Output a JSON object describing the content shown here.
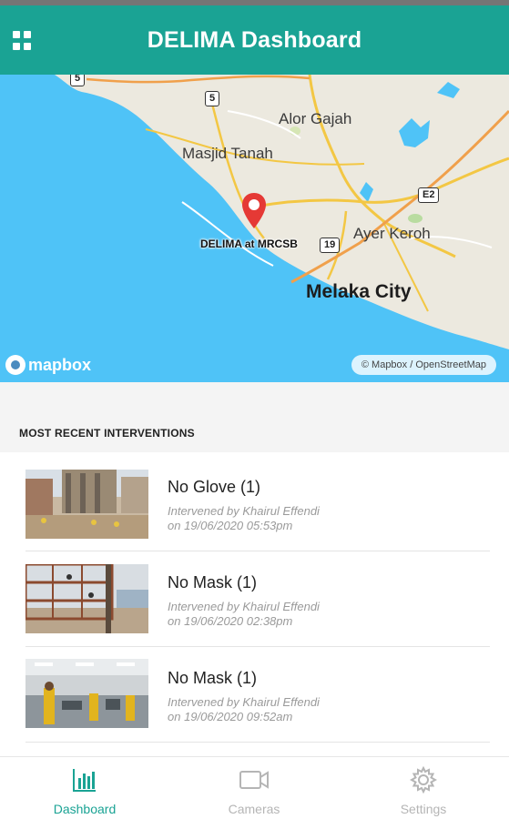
{
  "header": {
    "title": "DELIMA Dashboard",
    "menu_icon": "grid-menu-icon"
  },
  "map": {
    "places": {
      "alor_gajah": "Alor Gajah",
      "masjid_tanah": "Masjid Tanah",
      "ayer_keroh": "Ayer Keroh",
      "melaka_city": "Melaka City"
    },
    "shields": {
      "r5": "5",
      "r19": "19",
      "e2": "E2",
      "r_top": "5"
    },
    "marker_label": "DELIMA at MRCSB",
    "marker_color": "#e53935",
    "logo_text": "mapbox",
    "attribution": "© Mapbox / OpenStreetMap",
    "sea_color": "#4fc3f7",
    "land_color": "#ece9df"
  },
  "interventions": {
    "section_title": "MOST RECENT INTERVENTIONS",
    "items": [
      {
        "title": "No Glove (1)",
        "by": "Intervened by Khairul Effendi",
        "when": "on 19/06/2020 05:53pm"
      },
      {
        "title": "No Mask (1)",
        "by": "Intervened by Khairul Effendi",
        "when": "on 19/06/2020 02:38pm"
      },
      {
        "title": "No Mask (1)",
        "by": "Intervened by Khairul Effendi",
        "when": "on 19/06/2020 09:52am"
      }
    ]
  },
  "nav": {
    "items": [
      {
        "label": "Dashboard",
        "icon": "bar-chart-icon",
        "active": true
      },
      {
        "label": "Cameras",
        "icon": "video-camera-icon",
        "active": false
      },
      {
        "label": "Settings",
        "icon": "gear-icon",
        "active": false
      }
    ],
    "accent_color": "#1aa394",
    "inactive_color": "#b5b5b5"
  }
}
